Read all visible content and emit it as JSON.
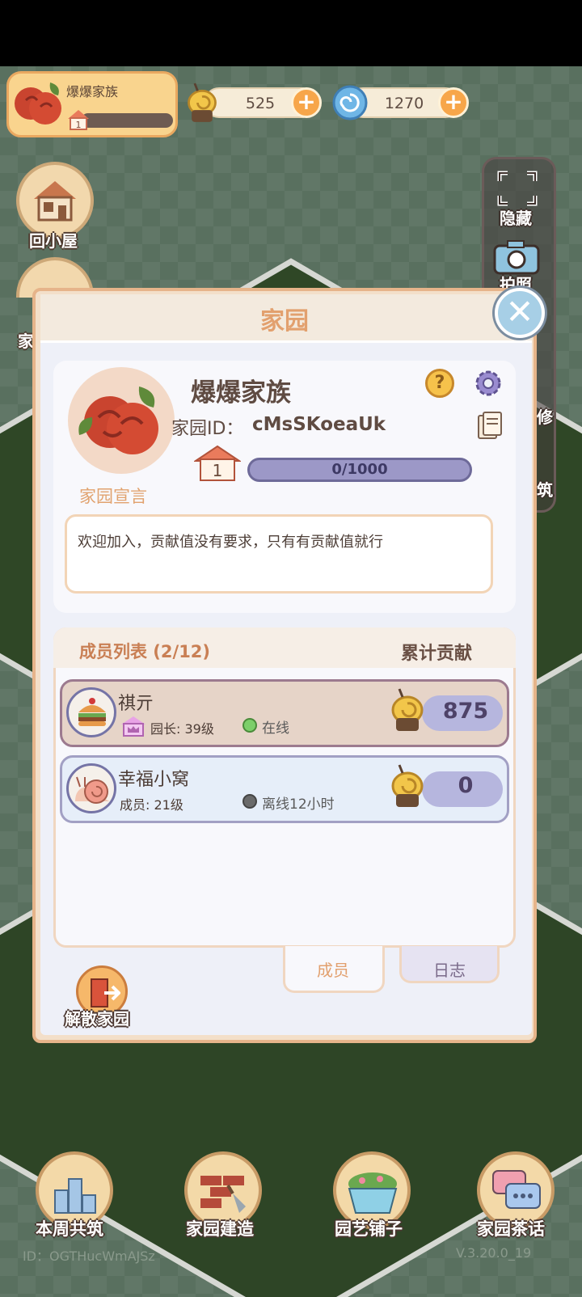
{
  "top_bar": {
    "family_name": "爆爆家族",
    "family_level": "1",
    "snail_currency": "525",
    "swirl_currency": "1270",
    "plus_symbol": "+"
  },
  "left_buttons": {
    "home_label": "回小屋",
    "family_label_partial": "家"
  },
  "side_panel": {
    "hide_label": "隐藏",
    "photo_label": "拍照",
    "repair_partial": "修",
    "build_partial": "筑"
  },
  "modal": {
    "title": "家园",
    "close_symbol": "✕",
    "family_name": "爆爆家族",
    "family_id_label": "家园ID：",
    "family_id": "cMsSKoeaUk",
    "help_symbol": "?",
    "level": "1",
    "exp_text": "0/1000",
    "exp_progress": 0,
    "declaration_label": "家园宣言",
    "declaration_text": "欢迎加入，贡献值没有要求，只有有贡献值就行",
    "member_list_title": "成员列表 (2/12)",
    "contribution_header": "累计贡献",
    "members": [
      {
        "name": "祺亓",
        "role": "园长: 39级",
        "status": "在线",
        "status_color": "#7ccf6a",
        "contribution": "875"
      },
      {
        "name": "幸福小窝",
        "role": "成员: 21级",
        "status": "离线12小时",
        "status_color": "#6a6a6a",
        "contribution": "0"
      }
    ],
    "tabs": {
      "members": "成员",
      "log": "日志"
    },
    "disband_label": "解散家园"
  },
  "bottom_bar": {
    "weekly_build": "本周共筑",
    "garden_build": "家园建造",
    "garden_shop": "园艺铺子",
    "garden_tea": "家园茶话"
  },
  "footer": {
    "player_id": "ID：OGTHucWmAJSz",
    "version": "V.3.20.0_19"
  },
  "colors": {
    "accent": "#e2a06e",
    "close_button": "#a7cfe6",
    "exp_bar": "#9c98c7"
  }
}
